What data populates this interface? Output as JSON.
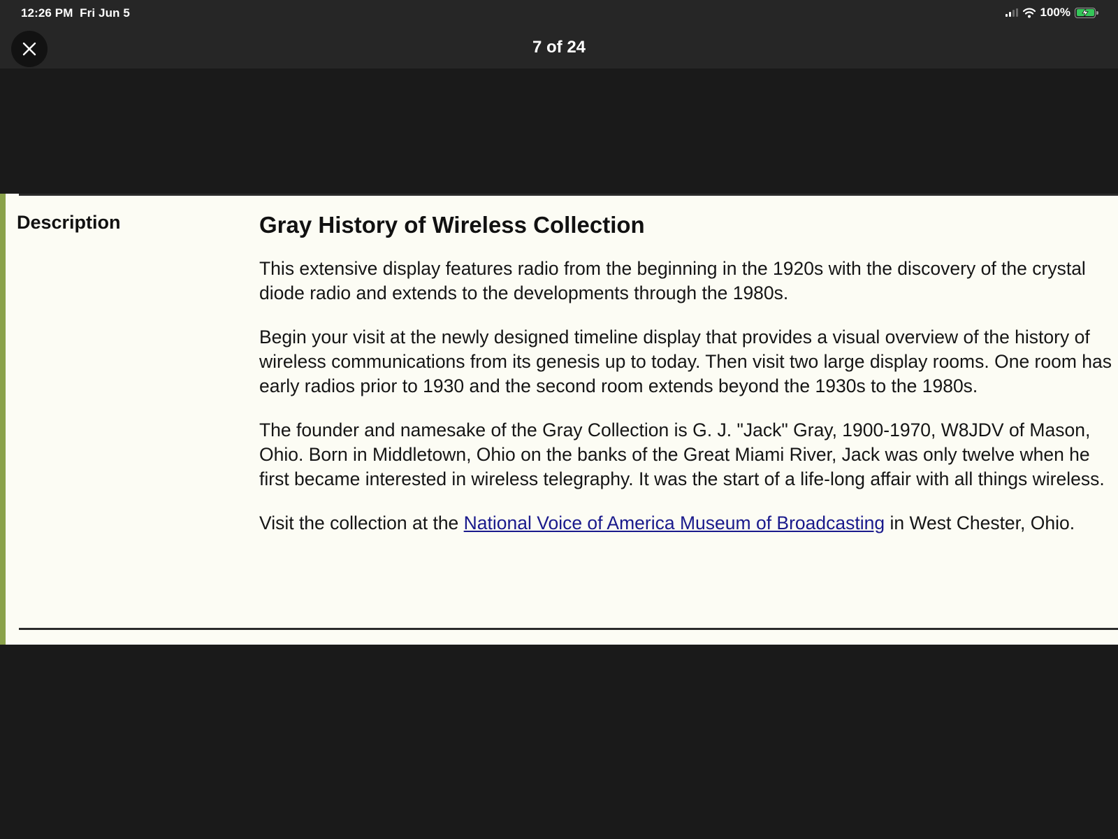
{
  "status_bar": {
    "time": "12:26 PM",
    "date": "Fri Jun 5",
    "battery": "100%"
  },
  "viewer": {
    "page_counter": "7 of 24",
    "close_icon": "close-icon"
  },
  "document": {
    "section_label": "Description",
    "title": "Gray History of Wireless Collection",
    "paragraphs": [
      "This extensive display features radio from the beginning in the 1920s with the discovery of the crystal diode radio and extends to the developments through the 1980s.",
      "Begin your visit at the newly designed timeline display that provides a visual overview of the history of wireless communications from its genesis up to today. Then visit two large display rooms. One room has early radios prior to 1930 and the second room extends beyond the 1930s to the 1980s.",
      "The founder and namesake of the Gray Collection is G. J. \"Jack\" Gray, 1900-1970, W8JDV of Mason, Ohio. Born in Middletown, Ohio on the banks of the Great Miami River, Jack was only twelve when he first became interested in wireless telegraphy. It was the start of a life-long affair with all things wireless."
    ],
    "visit": {
      "before": "Visit the collection at the ",
      "link_text": "National Voice of America Museum of Broadcasting",
      "after": " in West Chester, Ohio."
    }
  },
  "colors": {
    "panel_background": "#fcfcf4",
    "left_accent": "#8aa24a",
    "link": "#1a1a8c",
    "chrome_background": "#262626",
    "battery_fill": "#35c759"
  }
}
